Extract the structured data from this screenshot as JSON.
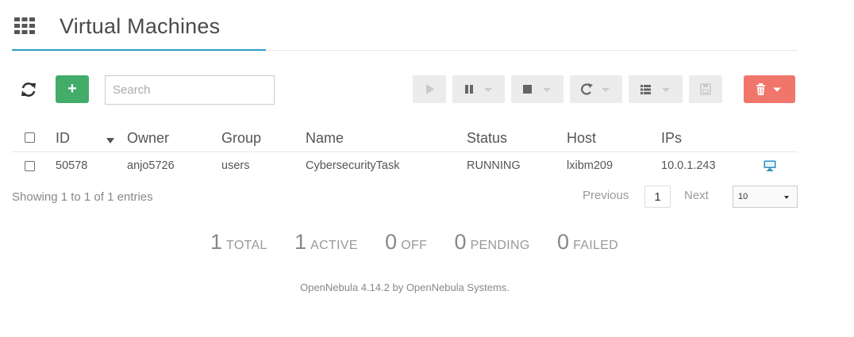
{
  "header": {
    "title": "Virtual Machines",
    "menu_icon": "grid-icon",
    "accent_color": "#2b9cc4"
  },
  "toolbar": {
    "refresh_icon": "refresh-icon",
    "add_label": "+",
    "add_color": "#43ac6a",
    "search_placeholder": "Search",
    "search_value": "",
    "buttons": [
      "play-icon",
      "pause-icon",
      "stop-icon",
      "reboot-icon",
      "list-icon",
      "save-icon"
    ],
    "delete_icon": "trash-icon",
    "delete_color": "#f0766b"
  },
  "table": {
    "columns": [
      "ID",
      "Owner",
      "Group",
      "Name",
      "Status",
      "Host",
      "IPs"
    ],
    "rows": [
      {
        "id": "50578",
        "owner": "anjo5726",
        "group": "users",
        "name": "CybersecurityTask",
        "status": "RUNNING",
        "host": "lxibm209",
        "ips": "10.0.1.243",
        "action_icon": "vnc-monitor-icon"
      }
    ]
  },
  "pagination": {
    "showing": "Showing 1 to 1 of 1 entries",
    "previous": "Previous",
    "current_page": "1",
    "next": "Next",
    "page_size": "10"
  },
  "summary": {
    "total": {
      "count": "1",
      "label": "TOTAL"
    },
    "active": {
      "count": "1",
      "label": "ACTIVE"
    },
    "off": {
      "count": "0",
      "label": "OFF"
    },
    "pending": {
      "count": "0",
      "label": "PENDING"
    },
    "failed": {
      "count": "0",
      "label": "FAILED"
    }
  },
  "footer": {
    "text": "OpenNebula 4.14.2 by OpenNebula Systems."
  }
}
